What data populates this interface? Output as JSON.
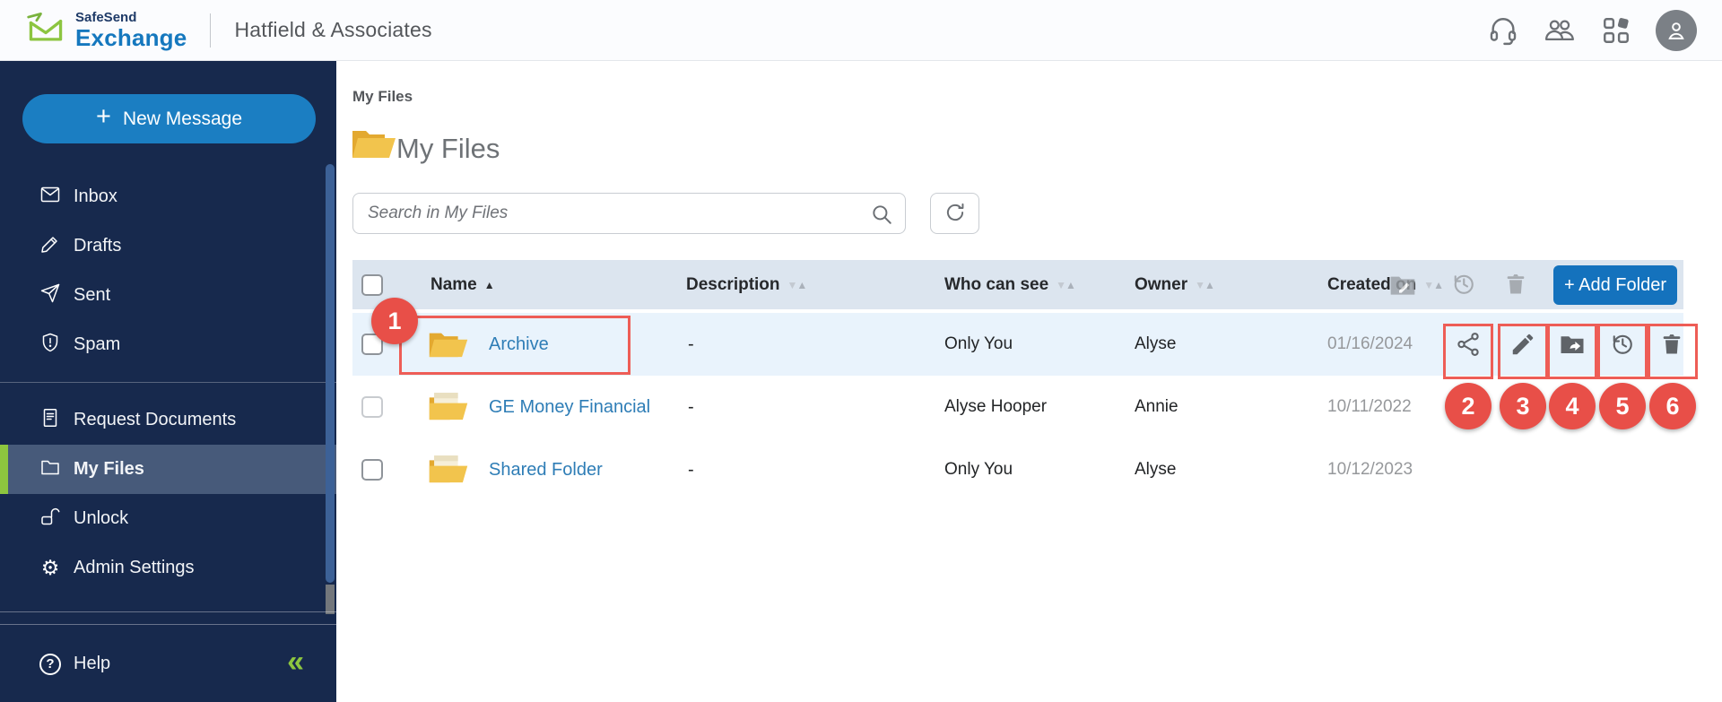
{
  "header": {
    "brand_top": "SafeSend",
    "brand_bottom": "Exchange",
    "company": "Hatfield & Associates"
  },
  "sidebar": {
    "new_message": "New Message",
    "items": [
      {
        "label": "Inbox"
      },
      {
        "label": "Drafts"
      },
      {
        "label": "Sent"
      },
      {
        "label": "Spam"
      },
      {
        "label": "Request Documents"
      },
      {
        "label": "My Files"
      },
      {
        "label": "Unlock"
      },
      {
        "label": "Admin Settings"
      }
    ],
    "help": "Help"
  },
  "main": {
    "breadcrumb": "My Files",
    "title": "My Files",
    "search_placeholder": "Search in My Files",
    "table": {
      "columns": [
        "Name",
        "Description",
        "Who can see",
        "Owner",
        "Created on"
      ],
      "add_folder": "+ Add Folder",
      "rows": [
        {
          "name": "Archive",
          "description": "-",
          "who_can_see": "Only You",
          "owner": "Alyse",
          "created_on": "01/16/2024"
        },
        {
          "name": "GE Money Financial",
          "description": "-",
          "who_can_see": "Alyse Hooper",
          "owner": "Annie",
          "created_on": "10/11/2022"
        },
        {
          "name": "Shared Folder",
          "description": "-",
          "who_can_see": "Only You",
          "owner": "Alyse",
          "created_on": "10/12/2023"
        }
      ]
    }
  },
  "annotations": {
    "n1": "1",
    "n2": "2",
    "n3": "3",
    "n4": "4",
    "n5": "5",
    "n6": "6"
  },
  "icons": {
    "plus": "+",
    "collapse": "«",
    "gear": "⚙",
    "question": "?",
    "sort_asc": "▲",
    "sort_down": "▼",
    "sort_up": "▲"
  },
  "colors": {
    "accent_blue": "#1b7ec2",
    "button_blue": "#1472bd",
    "brand_green": "#8dc63f",
    "annotation_red": "#e84f48",
    "link_blue": "#2e7db6",
    "sidebar_navy": "#17294d",
    "table_header_bg": "#dce5ef",
    "row_highlight": "#e9f3fc"
  }
}
